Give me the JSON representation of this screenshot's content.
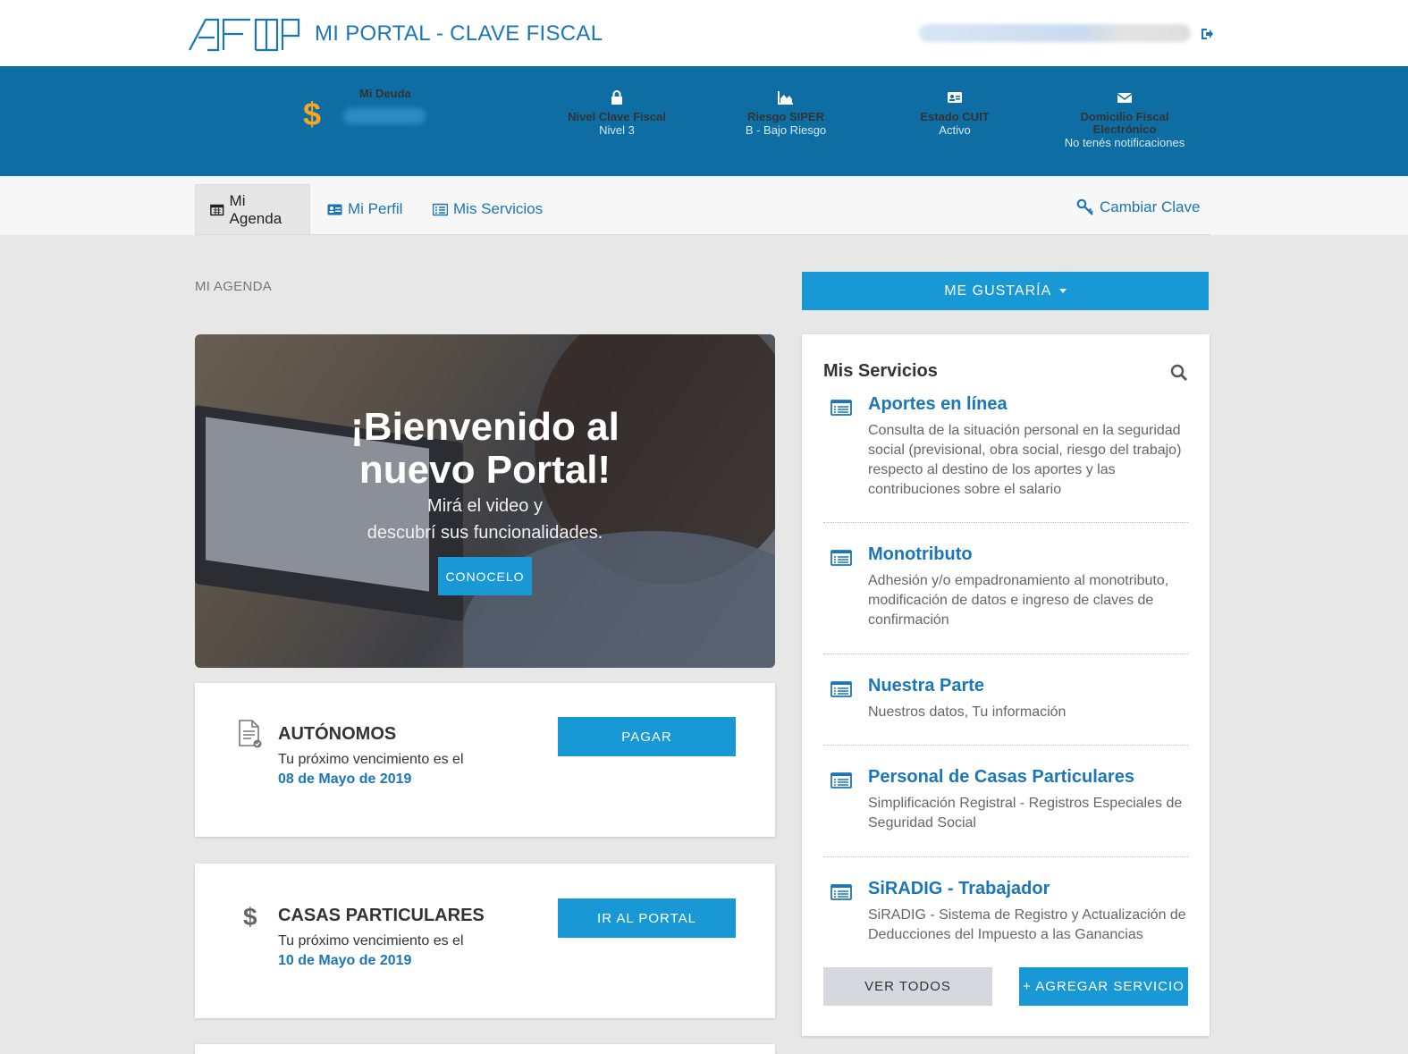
{
  "header": {
    "logo_text": "AFIP",
    "title": "MI PORTAL - CLAVE FISCAL"
  },
  "band": {
    "deuda_label": "Mi Deuda",
    "deuda_symbol": "$",
    "stats": [
      {
        "icon": "lock-icon",
        "title": "Nivel Clave Fiscal",
        "value": "Nivel 3"
      },
      {
        "icon": "area-chart-icon",
        "title": "Riesgo SIPER",
        "value": "B - Bajo Riesgo"
      },
      {
        "icon": "id-card-icon",
        "title": "Estado CUIT",
        "value": "Activo"
      },
      {
        "icon": "envelope-icon",
        "title": "Domicilio Fiscal Electrónico",
        "value": "No tenés notificaciones"
      }
    ]
  },
  "tabs": [
    {
      "label": "Mi Agenda",
      "icon": "calendar-icon"
    },
    {
      "label": "Mi Perfil",
      "icon": "id-card-icon"
    },
    {
      "label": "Mis Servicios",
      "icon": "list-icon"
    }
  ],
  "cambiar_clave": "Cambiar Clave",
  "agenda": {
    "section_title": "MI AGENDA",
    "hero": {
      "title_line1": "¡Bienvenido al",
      "title_line2": "nuevo Portal!",
      "sub_line1": "Mirá el video y",
      "sub_line2": "descubrí sus funcionalidades.",
      "button": "CONOCELO"
    },
    "cards": [
      {
        "icon": "document-check-icon",
        "title": "AUTÓNOMOS",
        "text": "Tu próximo vencimiento es el",
        "date": "08 de Mayo de 2019",
        "button": "PAGAR"
      },
      {
        "icon": "dollar-icon",
        "title": "CASAS PARTICULARES",
        "text": "Tu próximo vencimiento es el",
        "date": "10 de Mayo de 2019",
        "button": "IR AL PORTAL"
      }
    ]
  },
  "me_gustaria": "ME GUSTARÍA",
  "services": {
    "title": "Mis Servicios",
    "items": [
      {
        "title": "Aportes en línea",
        "desc": "Consulta de la situación personal en la seguridad social (previsional, obra social, riesgo del trabajo) respecto al destino de los aportes y las contribuciones sobre el salario"
      },
      {
        "title": "Monotributo",
        "desc": "Adhesión y/o empadronamiento al monotributo, modificación de datos e ingreso de claves de confirmación"
      },
      {
        "title": "Nuestra Parte",
        "desc": "Nuestros datos, Tu información"
      },
      {
        "title": "Personal de Casas Particulares",
        "desc": "Simplificación Registral - Registros Especiales de Seguridad Social"
      },
      {
        "title": "SiRADIG - Trabajador",
        "desc": "SiRADIG - Sistema de Registro y Actualización de Deducciones del Impuesto a las Ganancias"
      }
    ],
    "ver_todos": "VER TODOS",
    "agregar": "+ AGREGAR SERVICIO"
  },
  "colors": {
    "primary": "#0e6ea4",
    "accent": "#1898d5",
    "link": "#1a76b8",
    "dollar": "#f5a623"
  }
}
